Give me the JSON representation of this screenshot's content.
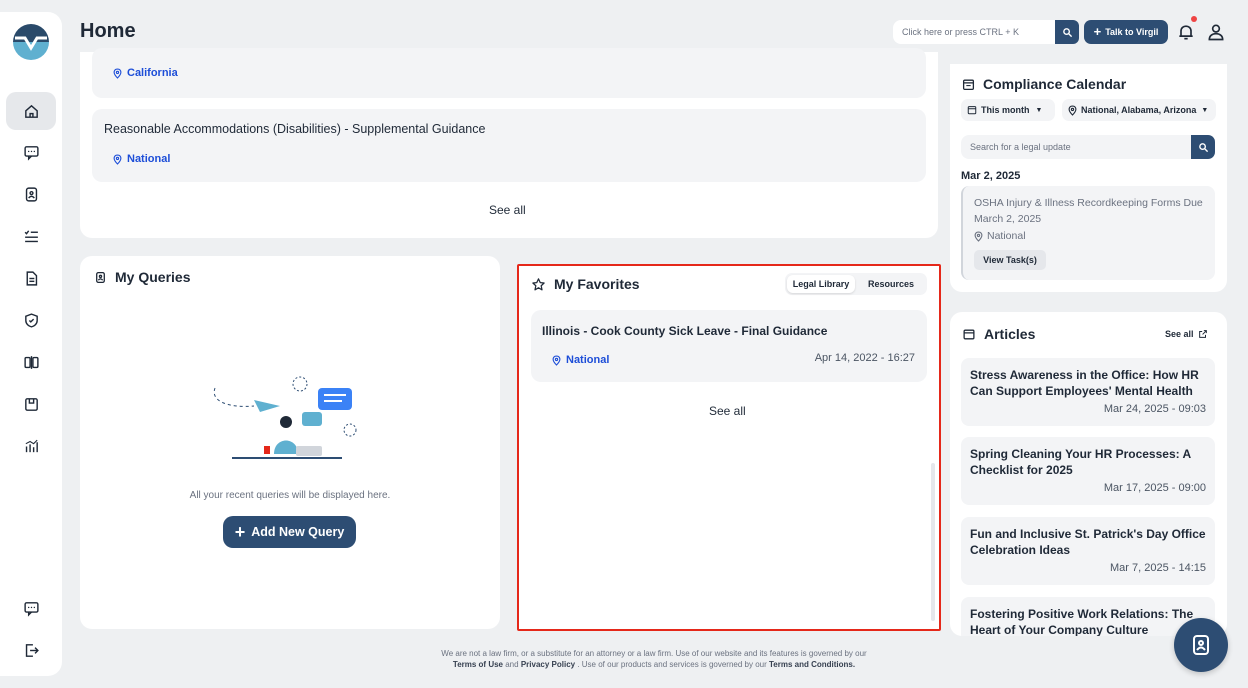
{
  "header": {
    "title": "Home",
    "search_placeholder": "Click here or press CTRL + K",
    "talk_label": "Talk to Virgil"
  },
  "top_list": {
    "items": [
      {
        "title": "",
        "location": "California"
      },
      {
        "title": "Reasonable Accommodations (Disabilities) - Supplemental Guidance",
        "location": "National"
      }
    ],
    "see_all": "See all"
  },
  "queries": {
    "title": "My Queries",
    "empty_text": "All your recent queries will be displayed here.",
    "add_label": "Add New Query"
  },
  "favorites": {
    "title": "My Favorites",
    "tabs": [
      "Legal Library",
      "Resources"
    ],
    "item": {
      "title": "Illinois - Cook County Sick Leave - Final Guidance",
      "location": "National",
      "date": "Apr 14, 2022 - 16:27"
    },
    "see_all": "See all"
  },
  "calendar": {
    "title": "Compliance Calendar",
    "period": "This month",
    "regions": "National, Alabama, Arizona",
    "search_placeholder": "Search for a legal update",
    "date": "Mar 2, 2025",
    "task": {
      "title": "OSHA Injury & Illness Recordkeeping Forms Due March 2, 2025",
      "location": "National",
      "button": "View Task(s)"
    }
  },
  "articles": {
    "title": "Articles",
    "see_all": "See all",
    "items": [
      {
        "title": "Stress Awareness in the Office: How HR Can Support Employees' Mental Health",
        "date": "Mar 24, 2025 - 09:03"
      },
      {
        "title": "Spring Cleaning Your HR Processes: A Checklist for 2025",
        "date": "Mar 17, 2025 - 09:00"
      },
      {
        "title": "Fun and Inclusive St. Patrick's Day Office Celebration Ideas",
        "date": "Mar 7, 2025 - 14:15"
      },
      {
        "title": "Fostering Positive Work Relations: The Heart of Your Company Culture",
        "date": ""
      }
    ]
  },
  "footer": {
    "line1": "We are not a law firm, or a substitute for an attorney or a law firm. Use of our website and its features is governed by our",
    "terms": "Terms of Use",
    "and": "and",
    "privacy": "Privacy Policy",
    "line2": ". Use of our products and services is governed by our",
    "conditions": "Terms and Conditions."
  },
  "colors": {
    "brand": "#2d4d73",
    "link": "#1d4ed8",
    "highlight": "#e5281a",
    "alert": "#ef4444"
  }
}
